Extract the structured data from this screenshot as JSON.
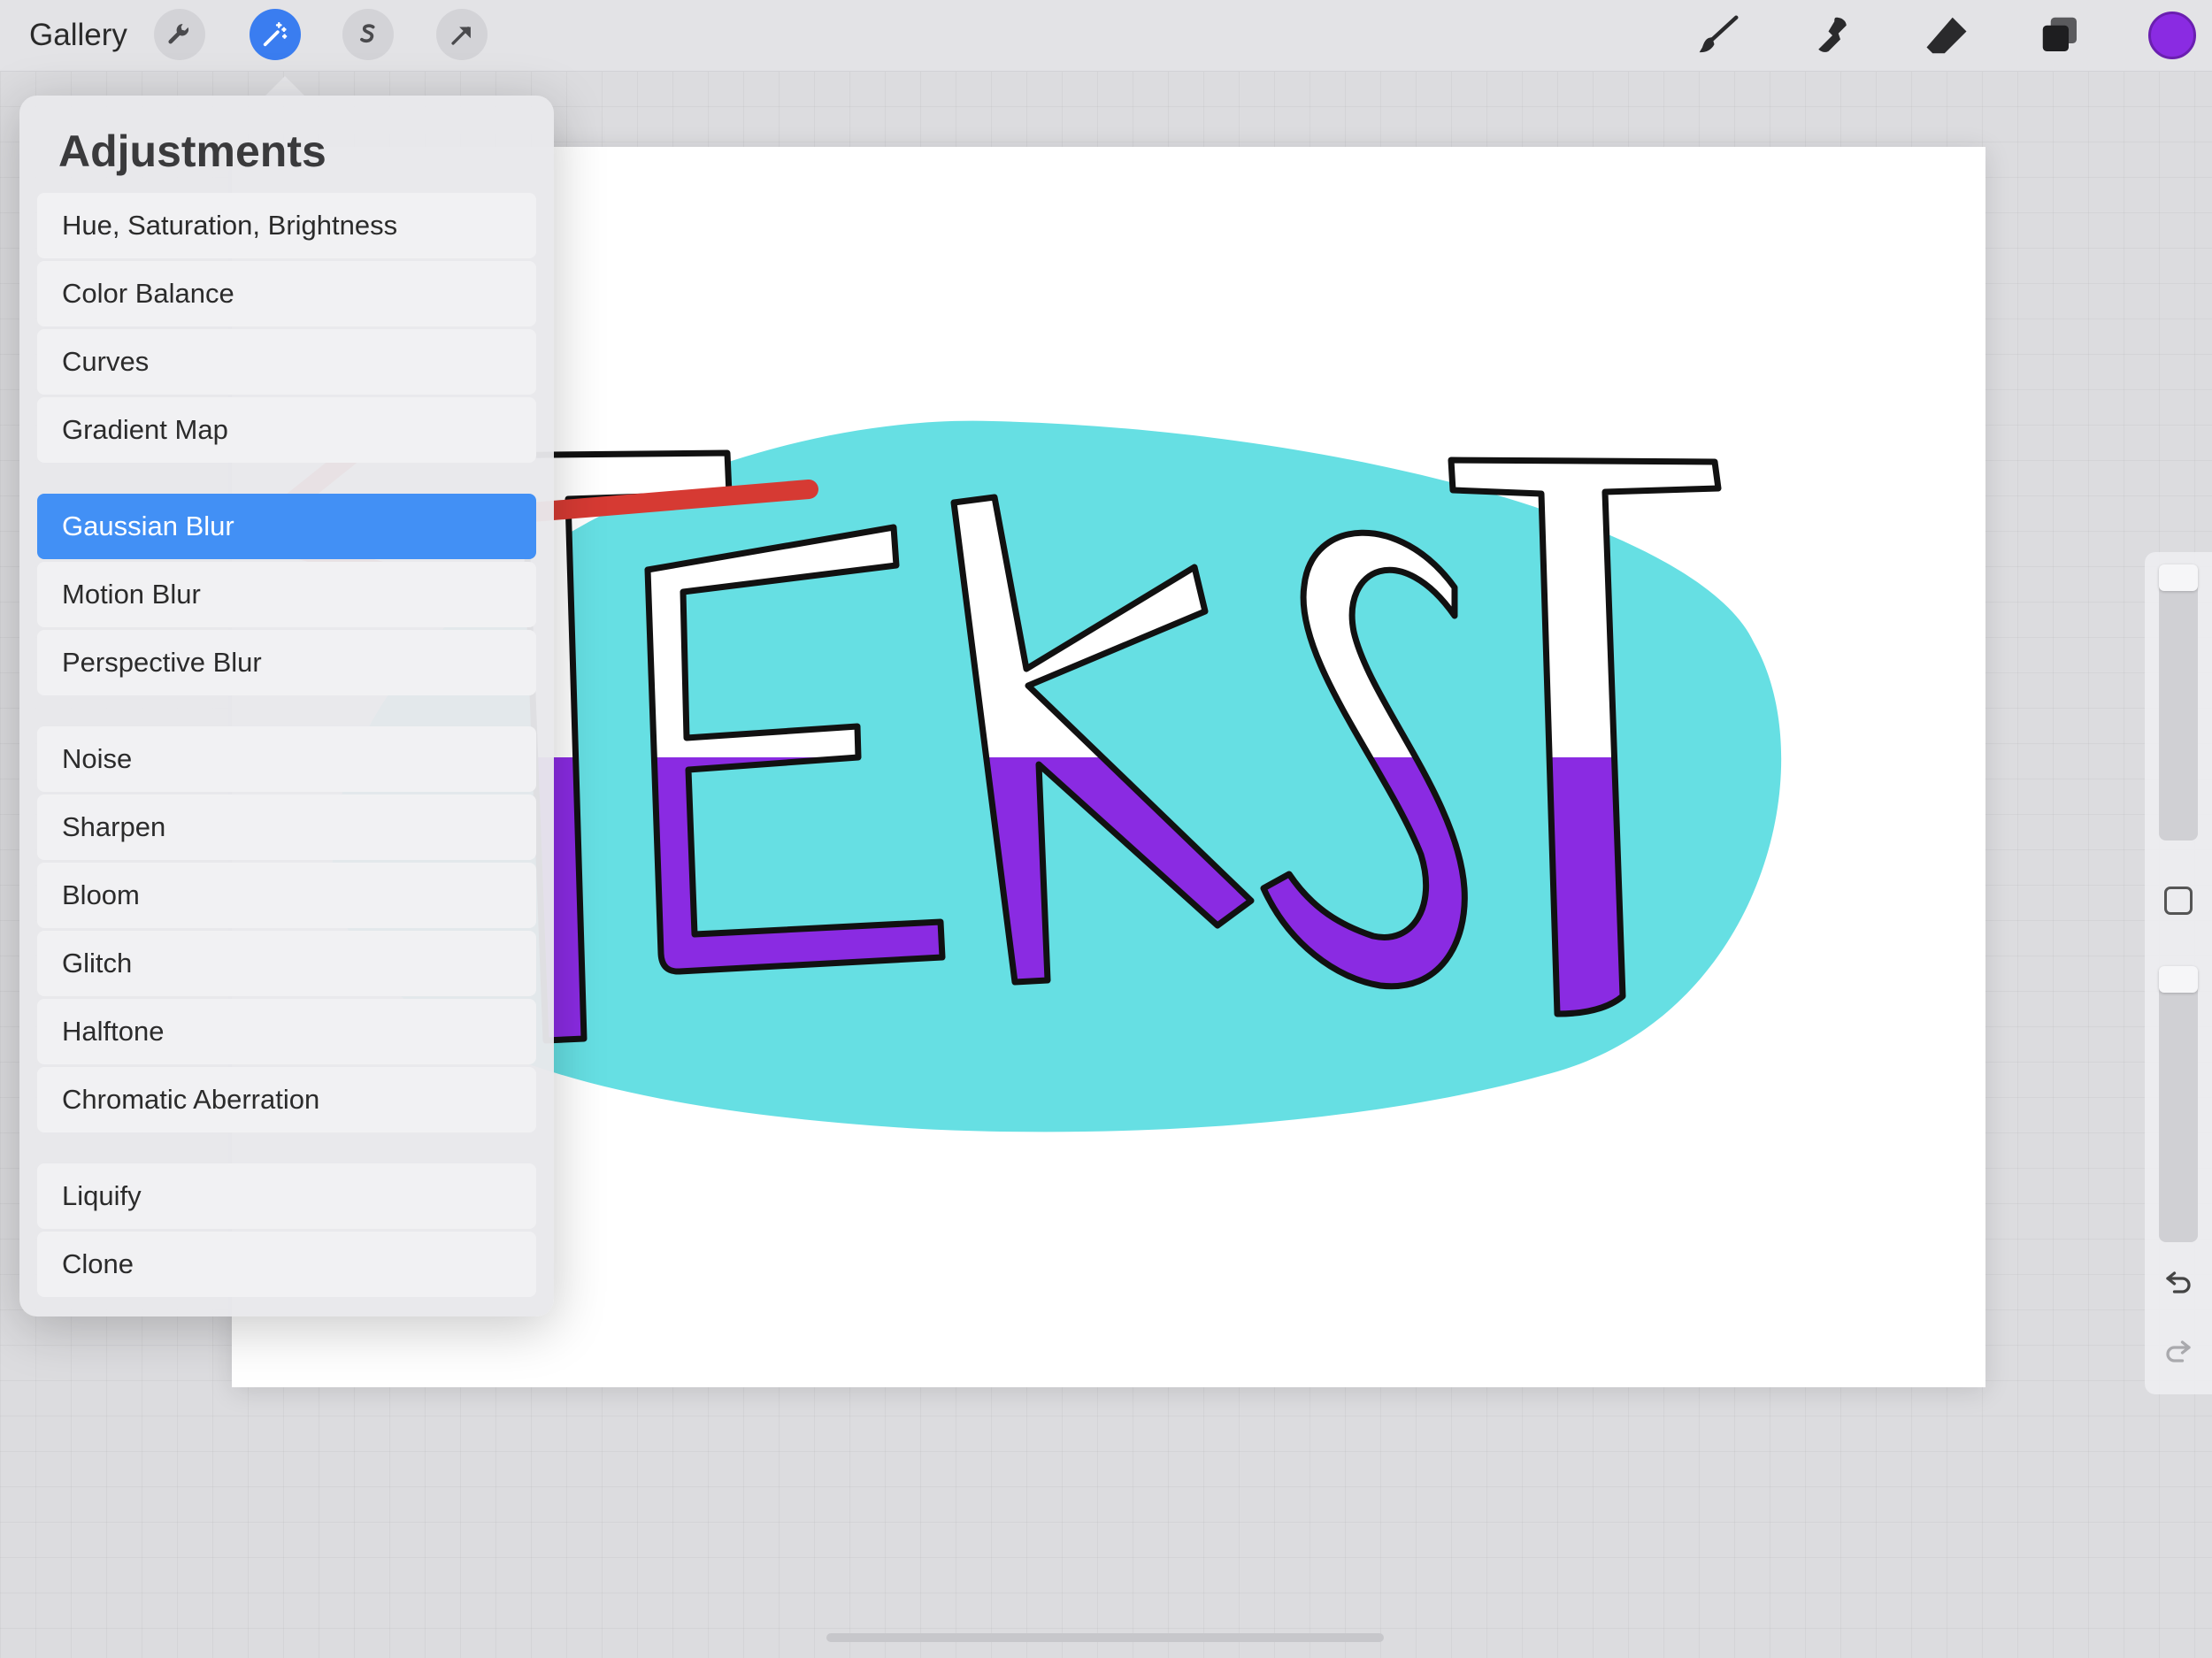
{
  "topbar": {
    "gallery_label": "Gallery",
    "left_tools": [
      "wrench-icon",
      "magic-wand-icon",
      "selection-s-icon",
      "transform-arrow-icon"
    ],
    "active_tool": "magic-wand-icon",
    "right_tools": [
      "brush-icon",
      "smudge-icon",
      "eraser-icon",
      "layers-icon"
    ],
    "current_color": "#8a2be2"
  },
  "adjustments": {
    "title": "Adjustments",
    "groups": [
      [
        "Hue, Saturation, Brightness",
        "Color Balance",
        "Curves",
        "Gradient Map"
      ],
      [
        "Gaussian Blur",
        "Motion Blur",
        "Perspective Blur"
      ],
      [
        "Noise",
        "Sharpen",
        "Bloom",
        "Glitch",
        "Halftone",
        "Chromatic Aberration"
      ],
      [
        "Liquify",
        "Clone"
      ]
    ],
    "selected": "Gaussian Blur"
  },
  "canvas": {
    "artwork_text": "TEKST",
    "colors": {
      "blob": "#66dfe3",
      "fill_bottom": "#8a2be2",
      "arrow": "#d63a33"
    }
  },
  "sidebar": {
    "controls": [
      "brush-size-slider",
      "modify-button",
      "opacity-slider",
      "undo-icon",
      "redo-icon"
    ]
  }
}
